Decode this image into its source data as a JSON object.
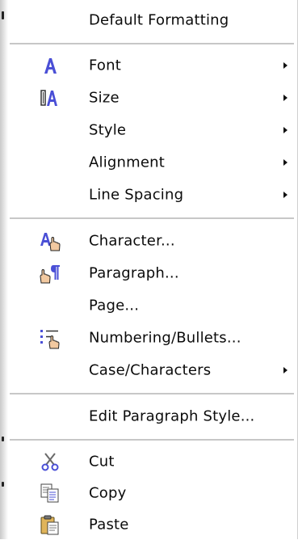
{
  "menu": {
    "items": [
      {
        "id": "default-formatting",
        "label": "Default Formatting",
        "submenu": false
      },
      {
        "id": "font",
        "label": "Font",
        "submenu": true,
        "icon": "font-A-icon"
      },
      {
        "id": "size",
        "label": "Size",
        "submenu": true,
        "icon": "font-size-icon"
      },
      {
        "id": "style",
        "label": "Style",
        "submenu": true
      },
      {
        "id": "alignment",
        "label": "Alignment",
        "submenu": true
      },
      {
        "id": "line-spacing",
        "label": "Line Spacing",
        "submenu": true
      },
      {
        "id": "character",
        "label": "Character...",
        "submenu": false,
        "icon": "character-icon"
      },
      {
        "id": "paragraph",
        "label": "Paragraph...",
        "submenu": false,
        "icon": "paragraph-icon"
      },
      {
        "id": "page",
        "label": "Page...",
        "submenu": false
      },
      {
        "id": "numbering-bullets",
        "label": "Numbering/Bullets...",
        "submenu": false,
        "icon": "numbering-bullets-icon"
      },
      {
        "id": "case-characters",
        "label": "Case/Characters",
        "submenu": true
      },
      {
        "id": "edit-paragraph-style",
        "label": "Edit Paragraph Style...",
        "submenu": false
      },
      {
        "id": "cut",
        "label": "Cut",
        "submenu": false,
        "icon": "scissors-icon"
      },
      {
        "id": "copy",
        "label": "Copy",
        "submenu": false,
        "icon": "copy-icon"
      },
      {
        "id": "paste",
        "label": "Paste",
        "submenu": false,
        "icon": "paste-icon"
      }
    ]
  },
  "colors": {
    "icon_blue": "#4a4fd6",
    "icon_orange": "#e38b1b",
    "separator": "#c7c7c7"
  }
}
